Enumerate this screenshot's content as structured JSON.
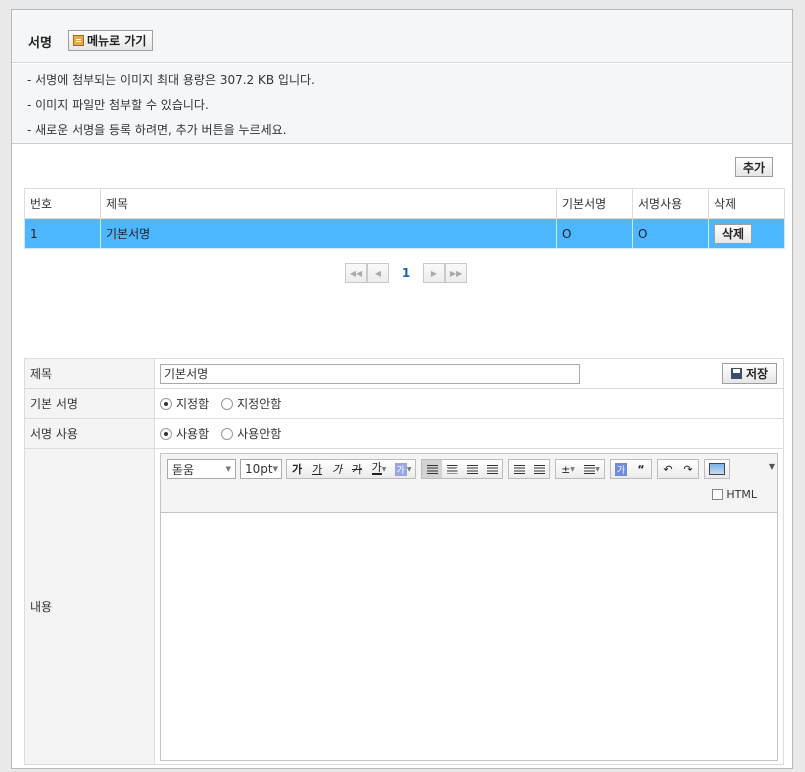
{
  "header": {
    "title": "서명",
    "menu_button": "메뉴로 가기"
  },
  "notice": [
    "- 서명에 첨부되는 이미지 최대 용량은 307.2 KB 입니다.",
    "- 이미지 파일만 첨부할 수 있습니다.",
    "- 새로운 서명을 등록 하려면, 추가 버튼을 누르세요."
  ],
  "add_button": "추가",
  "list": {
    "columns": [
      "번호",
      "제목",
      "기본서명",
      "서명사용",
      "삭제"
    ],
    "rows": [
      {
        "no": "1",
        "title": "기본서명",
        "default": "O",
        "use": "O",
        "delete_label": "삭제"
      }
    ]
  },
  "pagination": {
    "current": "1",
    "first_icon": "first-page-icon",
    "prev_icon": "prev-page-icon",
    "next_icon": "next-page-icon",
    "last_icon": "last-page-icon"
  },
  "form": {
    "title_label": "제목",
    "title_value": "기본서명",
    "save_label": "저장",
    "default_label": "기본 서명",
    "default_options": [
      "지정함",
      "지정안함"
    ],
    "default_selected": "지정함",
    "use_label": "서명 사용",
    "use_options": [
      "사용함",
      "사용안함"
    ],
    "use_selected": "사용함",
    "content_label": "내용"
  },
  "editor": {
    "font_family": "돋움",
    "font_size": "10pt",
    "bold": "가",
    "underline": "가",
    "italic": "가",
    "strike": "가",
    "font_color": "가",
    "highlight": "가",
    "insert_char": "가",
    "quote": "“",
    "html_label": "HTML",
    "icons": [
      "align-left-icon",
      "align-center-icon",
      "align-right-icon",
      "align-justify-icon",
      "indent-icon",
      "outdent-icon",
      "line-height-icon",
      "list-icon",
      "undo-icon",
      "redo-icon",
      "image-icon",
      "more-icon"
    ]
  }
}
